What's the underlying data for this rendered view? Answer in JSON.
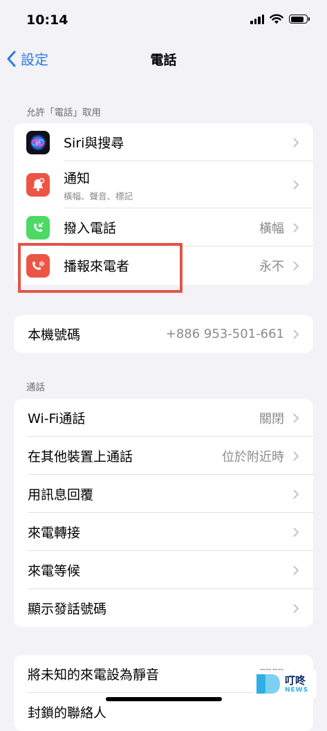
{
  "status": {
    "time": "10:14"
  },
  "nav": {
    "back_label": "設定",
    "title": "電話"
  },
  "section_allow": {
    "header": "允許「電話」取用",
    "items": [
      {
        "label": "Siri與搜尋",
        "value": "",
        "icon": "siri-icon"
      },
      {
        "label": "通知",
        "subtitle": "橫幅、聲音、標記",
        "value": "",
        "icon": "notification-bell-icon",
        "color": "#ec5546"
      },
      {
        "label": "撥入電話",
        "value": "橫幅",
        "icon": "incoming-call-icon",
        "color": "#4cd964"
      },
      {
        "label": "播報來電者",
        "value": "永不",
        "icon": "announce-calls-icon",
        "color": "#ec5546"
      }
    ]
  },
  "my_number": {
    "label": "本機號碼",
    "value": "+886 953-501-661"
  },
  "section_calls": {
    "header": "通話",
    "items": [
      {
        "label": "Wi-Fi通話",
        "value": "關閉"
      },
      {
        "label": "在其他裝置上通話",
        "value": "位於附近時"
      },
      {
        "label": "用訊息回覆",
        "value": ""
      },
      {
        "label": "來電轉接",
        "value": ""
      },
      {
        "label": "來電等候",
        "value": ""
      },
      {
        "label": "顯示發話號碼",
        "value": ""
      }
    ]
  },
  "section_silence": {
    "items": [
      {
        "label": "將未知的來電設為靜音",
        "value": "關閉"
      },
      {
        "label": "封鎖的聯絡人",
        "value": ""
      }
    ]
  },
  "watermark": {
    "cn": "叮咚",
    "en": "NEWS"
  }
}
